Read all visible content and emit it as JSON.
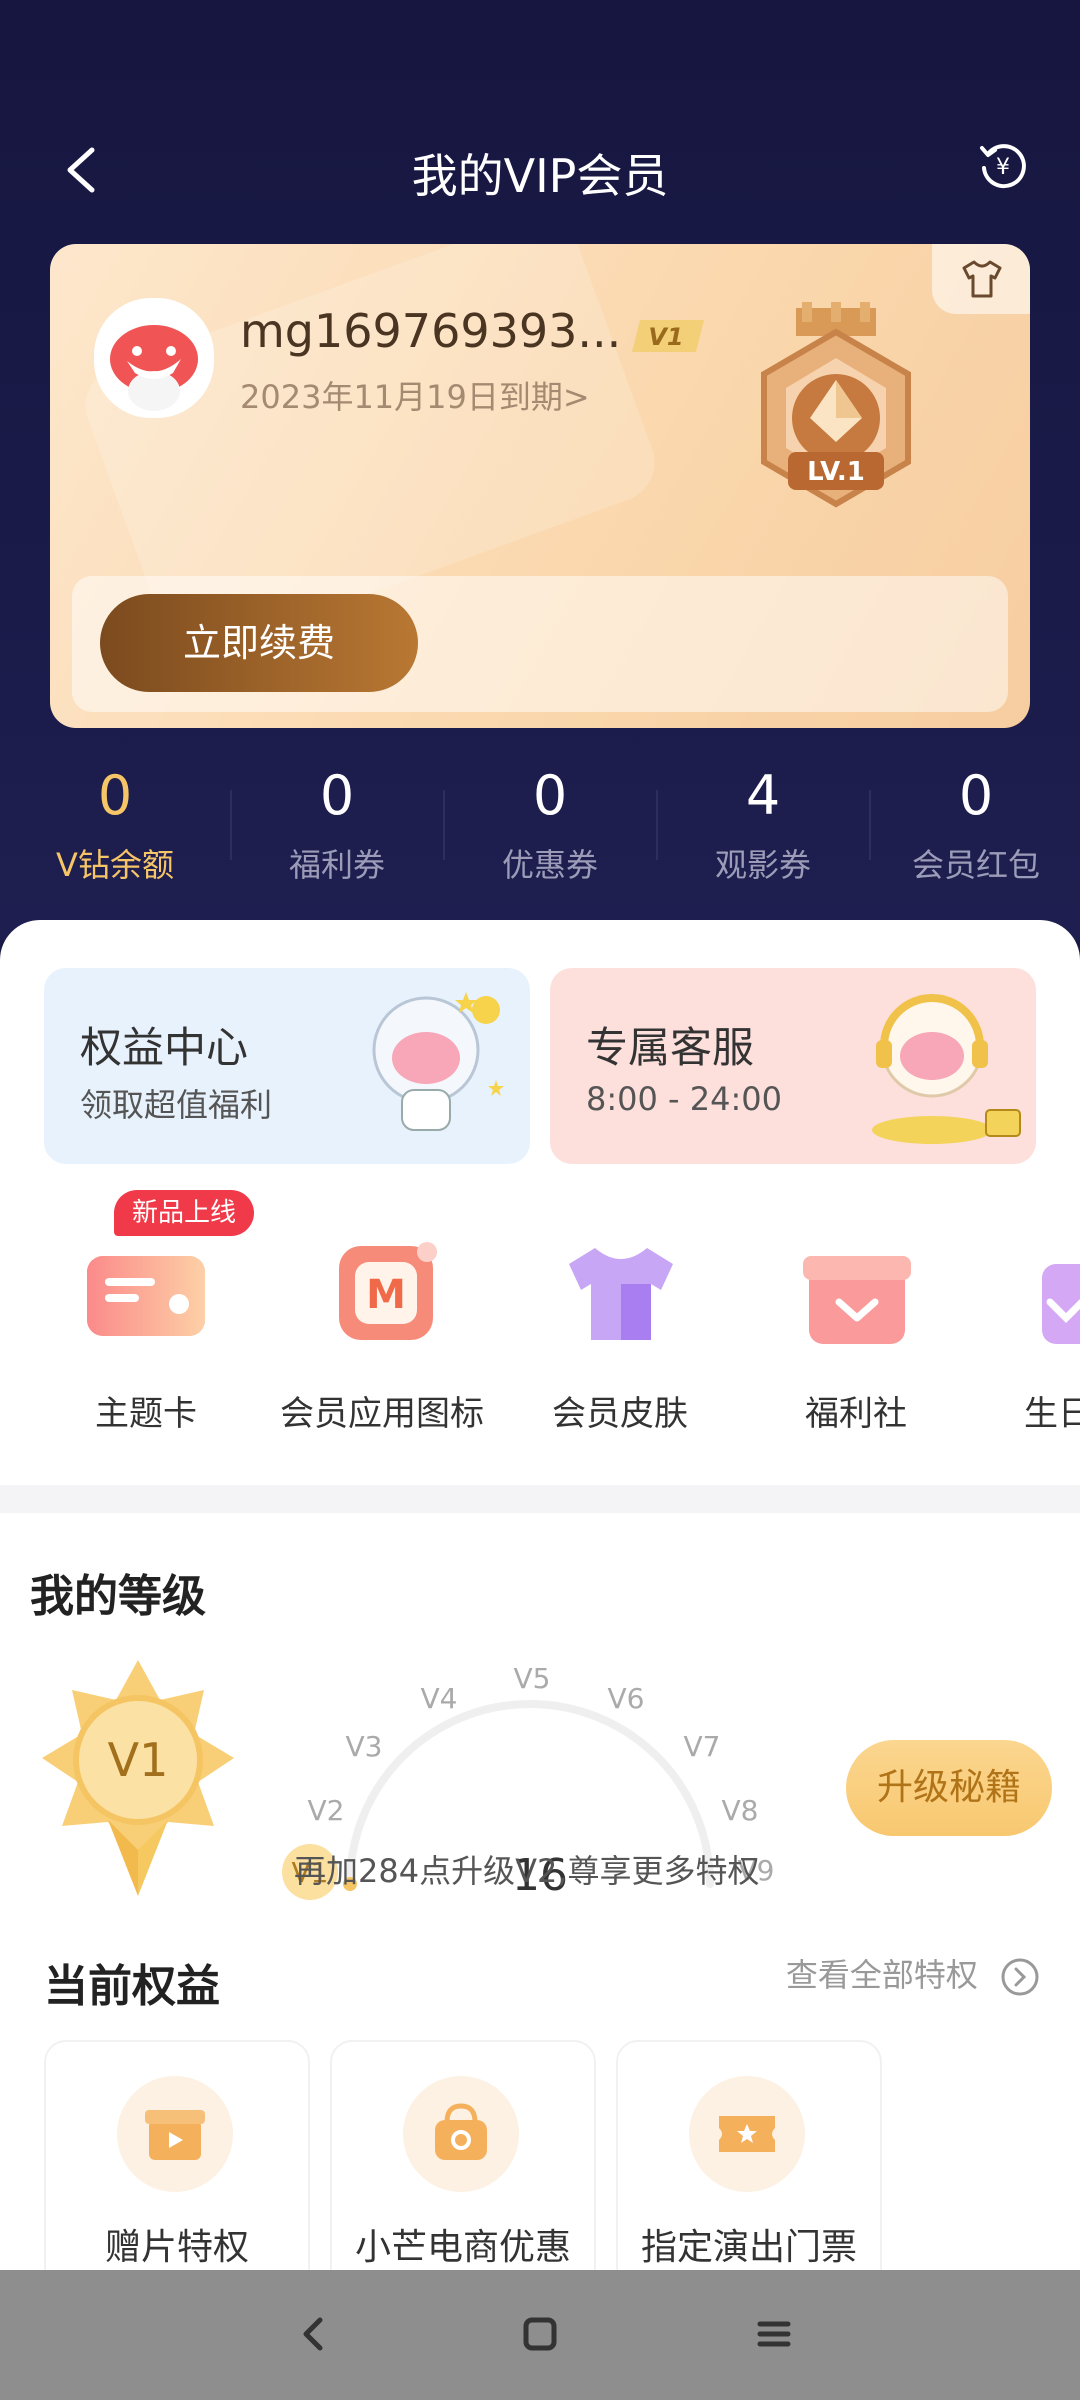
{
  "header": {
    "title": "我的VIP会员",
    "back_icon": "chevron-left-icon",
    "renew_icon": "yuan-refresh-icon"
  },
  "member_card": {
    "username": "mg169769393...",
    "vip_level_badge": "V1",
    "expiry": "2023年11月19日到期>",
    "medal_label": "LV.1",
    "renew_button": "立即续费",
    "shirt_icon": "tshirt-icon"
  },
  "stats": [
    {
      "value": "0",
      "label": "V钻余额",
      "active": true
    },
    {
      "value": "0",
      "label": "福利券"
    },
    {
      "value": "0",
      "label": "优惠券"
    },
    {
      "value": "4",
      "label": "观影券"
    },
    {
      "value": "0",
      "label": "会员红包"
    }
  ],
  "promo_cards": [
    {
      "title": "权益中心",
      "subtitle": "领取超值福利",
      "color": "#e8f2fc"
    },
    {
      "title": "专属客服",
      "subtitle": "8:00 - 24:00",
      "color": "#fde0dc"
    }
  ],
  "quick_tag": "新品上线",
  "quick_links": [
    {
      "label": "主题卡",
      "icon": "theme-card-icon"
    },
    {
      "label": "会员应用图标",
      "icon": "app-icon-icon"
    },
    {
      "label": "会员皮肤",
      "icon": "skin-shirt-icon"
    },
    {
      "label": "福利社",
      "icon": "gift-box-icon"
    },
    {
      "label": "生日",
      "icon": "birthday-icon"
    }
  ],
  "level": {
    "section_title": "我的等级",
    "current_badge": "V1",
    "score": "16",
    "ticks": [
      "V1",
      "V2",
      "V3",
      "V4",
      "V5",
      "V6",
      "V7",
      "V8",
      "V9"
    ],
    "hint": "再加284点升级V2,尊享更多特权",
    "upgrade_button": "升级秘籍"
  },
  "benefits": {
    "section_title": "当前权益",
    "see_all": "查看全部特权",
    "items": [
      {
        "label": "赠片特权",
        "icon": "gift-play-icon"
      },
      {
        "label": "小芒电商优惠",
        "icon": "shopping-bag-icon"
      },
      {
        "label": "指定演出门票",
        "icon": "ticket-star-icon"
      }
    ]
  },
  "colors": {
    "gold": "#f6c567",
    "dark_bg": "#1a1a44",
    "accent_red": "#f03a4a"
  }
}
